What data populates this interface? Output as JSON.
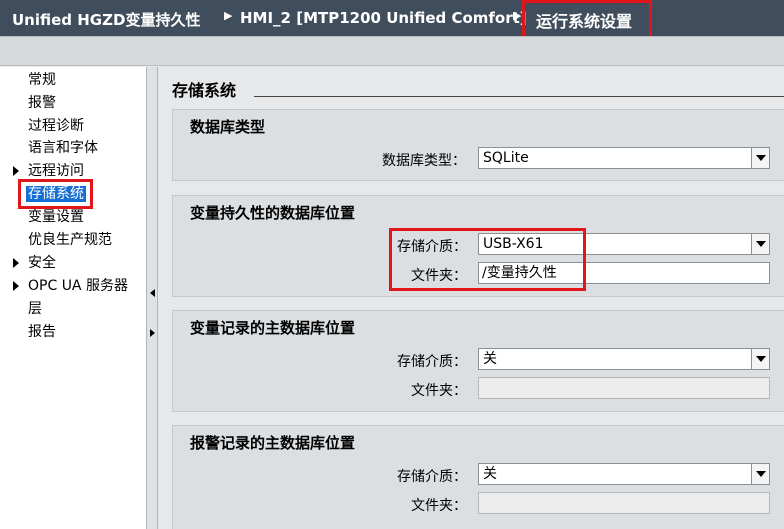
{
  "titlebar": {
    "project": "Unified HGZD变量持久性",
    "device": "HMI_2 [MTP1200 Unified Comfort]",
    "current": "运行系统设置"
  },
  "nav": {
    "items": [
      {
        "label": "常规",
        "expandable": false
      },
      {
        "label": "报警",
        "expandable": false
      },
      {
        "label": "过程诊断",
        "expandable": false
      },
      {
        "label": "语言和字体",
        "expandable": false
      },
      {
        "label": "远程访问",
        "expandable": true
      },
      {
        "label": "存储系统",
        "expandable": false,
        "selected": true
      },
      {
        "label": "变量设置",
        "expandable": false
      },
      {
        "label": "优良生产规范",
        "expandable": false
      },
      {
        "label": "安全",
        "expandable": true
      },
      {
        "label": "OPC UA 服务器",
        "expandable": true
      },
      {
        "label": "层",
        "expandable": false
      },
      {
        "label": "报告",
        "expandable": false
      }
    ]
  },
  "main": {
    "section_title": "存储系统",
    "db_type": {
      "title": "数据库类型",
      "label": "数据库类型：",
      "value": "SQLite"
    },
    "tag_persistence": {
      "title": "变量持久性的数据库位置",
      "medium_label": "存储介质：",
      "medium_value": "USB-X61",
      "folder_label": "文件夹：",
      "folder_value": "/变量持久性"
    },
    "tag_logging": {
      "title": "变量记录的主数据库位置",
      "medium_label": "存储介质：",
      "medium_value": "关",
      "folder_label": "文件夹：",
      "folder_value": ""
    },
    "alarm_logging": {
      "title": "报警记录的主数据库位置",
      "medium_label": "存储介质：",
      "medium_value": "关",
      "folder_label": "文件夹：",
      "folder_value": ""
    }
  }
}
